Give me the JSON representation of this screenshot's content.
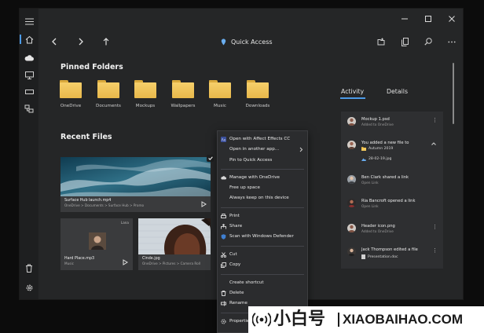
{
  "titlebar": {
    "menu_icon": "hamburger-icon",
    "minimize_icon": "minimize-icon",
    "maximize_icon": "maximize-icon",
    "close_icon": "close-icon"
  },
  "navigation": {
    "back_icon": "chevron-left-icon",
    "forward_icon": "chevron-right-icon",
    "up_icon": "arrow-up-icon",
    "location_label": "Quick Access",
    "location_icon": "pin-icon"
  },
  "top_actions": [
    "new-folder-icon",
    "copy-icon",
    "search-icon",
    "more-icon"
  ],
  "rail": {
    "items": [
      "home-icon",
      "cloud-icon",
      "computer-icon",
      "drive-icon",
      "network-icon"
    ],
    "bottom_items": [
      "trash-icon",
      "settings-icon"
    ]
  },
  "pinned": {
    "title": "Pinned Folders",
    "folders": [
      "OneDrive",
      "Documents",
      "Mockups",
      "Wallpapers",
      "Music",
      "Downloads"
    ]
  },
  "recent": {
    "title": "Recent Files",
    "files": [
      {
        "name": "Surface Hub launch.mp4",
        "path": "OneDrive > Documents > Surface Hub > Promo"
      },
      {
        "name": "Hard Place.mp3",
        "path": "Music",
        "badge": "Lana"
      },
      {
        "name": "Cinde.jpg",
        "path": "OneDrive > Pictures > Camera Roll"
      }
    ]
  },
  "tabs": {
    "activity": "Activity",
    "details": "Details"
  },
  "activity": [
    {
      "title": "Mockup 1.psd",
      "sub": "Added to OneDrive"
    },
    {
      "title": "You added a new file to",
      "folder": "Autumn 2019",
      "file": "28-02-19.jpg"
    },
    {
      "title": "Ben Clark shared a link",
      "sub": "Open Link"
    },
    {
      "title": "Ria Bancroft opened a link",
      "sub": "Open Link"
    },
    {
      "title": "Header icon.png",
      "sub": "Added to OneDrive"
    },
    {
      "title": "Jack Thompson edited a file",
      "file": "Presentation.doc"
    }
  ],
  "context_menu": {
    "items": [
      {
        "label": "Open with Affect Effects CC",
        "icon": "app-icon"
      },
      {
        "label": "Open in another app...",
        "submenu": true
      },
      {
        "label": "Pin to Quick Access"
      },
      {
        "label": "Manage with OneDrive",
        "icon": "cloud-icon"
      },
      {
        "label": "Free up space"
      },
      {
        "label": "Always keep on this device"
      },
      {
        "label": "Print",
        "icon": "print-icon"
      },
      {
        "label": "Share",
        "icon": "share-icon"
      },
      {
        "label": "Scan with Windows Defender",
        "icon": "shield-icon"
      },
      {
        "label": "Cut",
        "icon": "scissors-icon"
      },
      {
        "label": "Copy",
        "icon": "copy-icon"
      },
      {
        "label": "Create shortcut"
      },
      {
        "label": "Delete",
        "icon": "trash-icon"
      },
      {
        "label": "Rename",
        "icon": "rename-icon"
      },
      {
        "label": "Properties",
        "icon": "properties-icon"
      }
    ]
  },
  "banner": {
    "logo_icon": "broadcast-icon",
    "cn_text": "小白号",
    "en_text": "XIAOBAIHAO.COM"
  },
  "watermark": {
    "text": "XIAOBAIHAO.COM",
    "text_cn": "小白号"
  },
  "colors": {
    "accent": "#4c9ae6",
    "folder": "#f2c85c",
    "window_bg": "#252627",
    "panel_bg": "#2e2f31"
  }
}
